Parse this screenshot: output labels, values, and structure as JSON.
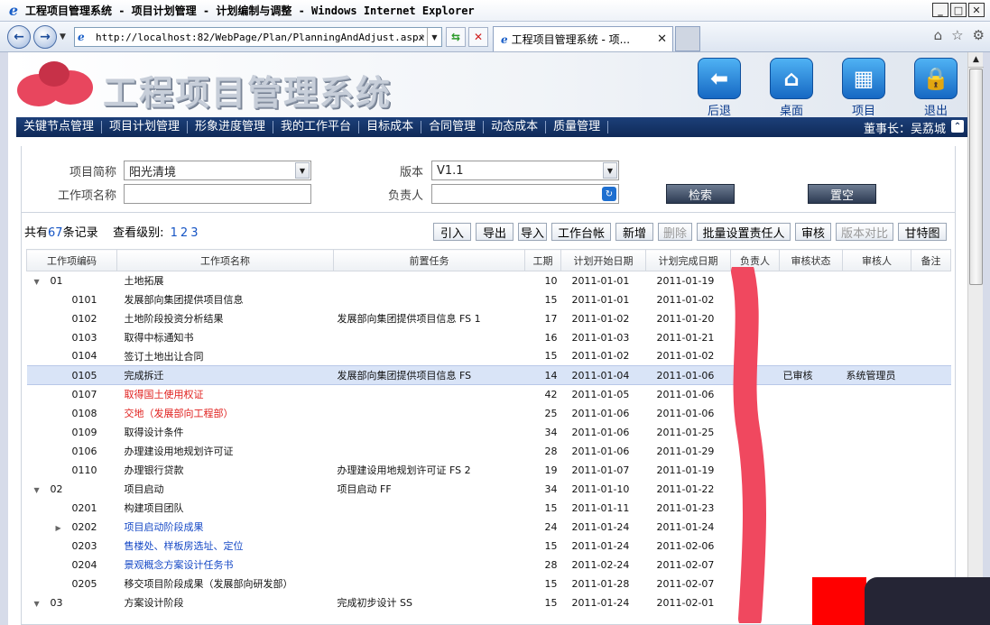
{
  "window": {
    "title": "工程项目管理系统 - 项目计划管理 - 计划编制与调整 - Windows Internet Explorer",
    "url": "http://localhost:82/WebPage/Plan/PlanningAndAdjust.aspx",
    "tab_label": "工程项目管理系统 - 项..."
  },
  "app": {
    "title": "工程项目管理系统",
    "top_nav": [
      {
        "label": "后退",
        "icon": "back-arrow-icon"
      },
      {
        "label": "桌面",
        "icon": "home-icon"
      },
      {
        "label": "项目",
        "icon": "building-icon"
      },
      {
        "label": "退出",
        "icon": "lock-icon"
      }
    ],
    "menu": [
      "关键节点管理",
      "项目计划管理",
      "形象进度管理",
      "我的工作平台",
      "目标成本",
      "合同管理",
      "动态成本",
      "质量管理"
    ],
    "user": "董事长：吴荔城"
  },
  "filters": {
    "project_label": "项目简称",
    "project_value": "阳光清境",
    "version_label": "版本",
    "version_value": "V1.1",
    "workitem_label": "工作项名称",
    "workitem_value": "",
    "owner_label": "负责人",
    "owner_value": "",
    "search_btn": "检索",
    "reset_btn": "置空"
  },
  "summary": {
    "prefix": "共有",
    "count": "67",
    "suffix": "条记录",
    "level_label": "查看级别:",
    "levels": [
      "1",
      "2",
      "3"
    ]
  },
  "toolbar": [
    {
      "label": "引入",
      "enabled": true
    },
    {
      "label": "导出",
      "enabled": true
    },
    {
      "label": "导入",
      "enabled": true
    },
    {
      "label": "工作台帐",
      "enabled": true
    },
    {
      "label": "新增",
      "enabled": true
    },
    {
      "label": "删除",
      "enabled": false
    },
    {
      "label": "批量设置责任人",
      "enabled": true
    },
    {
      "label": "审核",
      "enabled": true
    },
    {
      "label": "版本对比",
      "enabled": false
    },
    {
      "label": "甘特图",
      "enabled": true
    }
  ],
  "columns": [
    "工作项编码",
    "工作项名称",
    "前置任务",
    "工期",
    "计划开始日期",
    "计划完成日期",
    "负责人",
    "审核状态",
    "审核人",
    "备注"
  ],
  "rows": [
    {
      "toggle": "▼",
      "level": 0,
      "code": "01",
      "name": "土地拓展",
      "pre": "",
      "dur": "10",
      "start": "2011-01-01",
      "end": "2011-01-19",
      "owner": "",
      "status": "",
      "auditor": "",
      "note": "",
      "color": ""
    },
    {
      "toggle": "",
      "level": 1,
      "code": "0101",
      "name": "发展部向集团提供项目信息",
      "pre": "",
      "dur": "15",
      "start": "2011-01-01",
      "end": "2011-01-02",
      "owner": "",
      "status": "",
      "auditor": "",
      "note": "",
      "color": ""
    },
    {
      "toggle": "",
      "level": 1,
      "code": "0102",
      "name": "土地阶段投资分析结果",
      "pre": "发展部向集团提供项目信息 FS 1",
      "dur": "17",
      "start": "2011-01-02",
      "end": "2011-01-20",
      "owner": "",
      "status": "",
      "auditor": "",
      "note": "",
      "color": ""
    },
    {
      "toggle": "",
      "level": 1,
      "code": "0103",
      "name": "取得中标通知书",
      "pre": "",
      "dur": "16",
      "start": "2011-01-03",
      "end": "2011-01-21",
      "owner": "",
      "status": "",
      "auditor": "",
      "note": "",
      "color": ""
    },
    {
      "toggle": "",
      "level": 1,
      "code": "0104",
      "name": "签订土地出让合同",
      "pre": "",
      "dur": "15",
      "start": "2011-01-02",
      "end": "2011-01-02",
      "owner": "",
      "status": "",
      "auditor": "",
      "note": "",
      "color": ""
    },
    {
      "toggle": "",
      "level": 1,
      "code": "0105",
      "name": "完成拆迁",
      "pre": "发展部向集团提供项目信息 FS",
      "dur": "14",
      "start": "2011-01-04",
      "end": "2011-01-06",
      "owner": "",
      "status": "已审核",
      "auditor": "系统管理员",
      "note": "",
      "color": "",
      "selected": true
    },
    {
      "toggle": "",
      "level": 1,
      "code": "0107",
      "name": "取得国土使用权证",
      "pre": "",
      "dur": "42",
      "start": "2011-01-05",
      "end": "2011-01-06",
      "owner": "",
      "status": "",
      "auditor": "",
      "note": "",
      "color": "red"
    },
    {
      "toggle": "",
      "level": 1,
      "code": "0108",
      "name": "交地（发展部向工程部）",
      "pre": "",
      "dur": "25",
      "start": "2011-01-06",
      "end": "2011-01-06",
      "owner": "",
      "status": "",
      "auditor": "",
      "note": "",
      "color": "red"
    },
    {
      "toggle": "",
      "level": 1,
      "code": "0109",
      "name": "取得设计条件",
      "pre": "",
      "dur": "34",
      "start": "2011-01-06",
      "end": "2011-01-25",
      "owner": "",
      "status": "",
      "auditor": "",
      "note": "",
      "color": ""
    },
    {
      "toggle": "",
      "level": 1,
      "code": "0106",
      "name": "办理建设用地规划许可证",
      "pre": "",
      "dur": "28",
      "start": "2011-01-06",
      "end": "2011-01-29",
      "owner": "",
      "status": "",
      "auditor": "",
      "note": "",
      "color": ""
    },
    {
      "toggle": "",
      "level": 1,
      "code": "0110",
      "name": "办理银行贷款",
      "pre": "办理建设用地规划许可证 FS 2",
      "dur": "19",
      "start": "2011-01-07",
      "end": "2011-01-19",
      "owner": "",
      "status": "",
      "auditor": "",
      "note": "",
      "color": ""
    },
    {
      "toggle": "▼",
      "level": 0,
      "code": "02",
      "name": "项目启动",
      "pre": "项目启动 FF",
      "dur": "34",
      "start": "2011-01-10",
      "end": "2011-01-22",
      "owner": "",
      "status": "",
      "auditor": "",
      "note": "",
      "color": ""
    },
    {
      "toggle": "",
      "level": 1,
      "code": "0201",
      "name": "构建项目团队",
      "pre": "",
      "dur": "15",
      "start": "2011-01-11",
      "end": "2011-01-23",
      "owner": "",
      "status": "",
      "auditor": "",
      "note": "",
      "color": ""
    },
    {
      "toggle": "▶",
      "level": 1,
      "code": "0202",
      "name": "项目启动阶段成果",
      "pre": "",
      "dur": "24",
      "start": "2011-01-24",
      "end": "2011-01-24",
      "owner": "",
      "status": "",
      "auditor": "",
      "note": "",
      "color": "blue"
    },
    {
      "toggle": "",
      "level": 1,
      "code": "0203",
      "name": "售楼处、样板房选址、定位",
      "pre": "",
      "dur": "15",
      "start": "2011-01-24",
      "end": "2011-02-06",
      "owner": "",
      "status": "",
      "auditor": "",
      "note": "",
      "color": "blue"
    },
    {
      "toggle": "",
      "level": 1,
      "code": "0204",
      "name": "景观概念方案设计任务书",
      "pre": "",
      "dur": "28",
      "start": "2011-02-24",
      "end": "2011-02-07",
      "owner": "",
      "status": "",
      "auditor": "",
      "note": "",
      "color": "blue"
    },
    {
      "toggle": "",
      "level": 1,
      "code": "0205",
      "name": "移交项目阶段成果（发展部向研发部）",
      "pre": "",
      "dur": "15",
      "start": "2011-01-28",
      "end": "2011-02-07",
      "owner": "",
      "status": "",
      "auditor": "",
      "note": "",
      "color": ""
    },
    {
      "toggle": "▼",
      "level": 0,
      "code": "03",
      "name": "方案设计阶段",
      "pre": "完成初步设计 SS",
      "dur": "15",
      "start": "2011-01-24",
      "end": "2011-02-01",
      "owner": "",
      "status": "",
      "auditor": "",
      "note": "",
      "color": ""
    }
  ]
}
